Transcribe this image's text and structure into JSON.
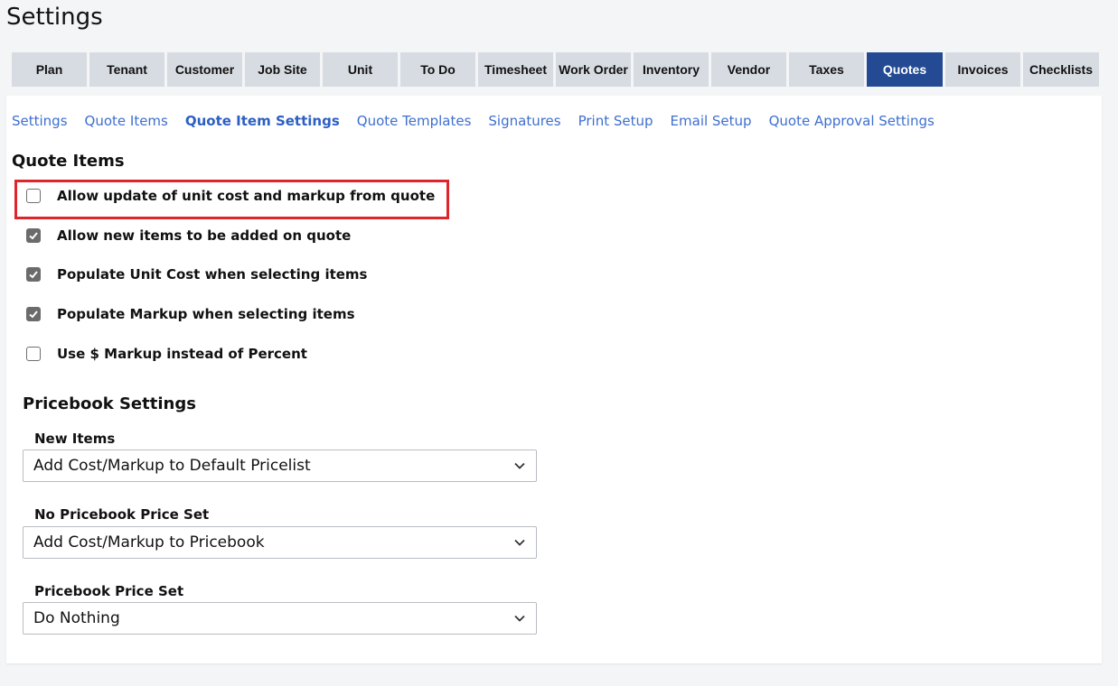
{
  "page": {
    "title": "Settings"
  },
  "tabs": [
    {
      "label": "Plan",
      "active": false
    },
    {
      "label": "Tenant",
      "active": false
    },
    {
      "label": "Customer",
      "active": false
    },
    {
      "label": "Job Site",
      "active": false
    },
    {
      "label": "Unit",
      "active": false
    },
    {
      "label": "To Do",
      "active": false
    },
    {
      "label": "Timesheet",
      "active": false
    },
    {
      "label": "Work Order",
      "active": false
    },
    {
      "label": "Inventory",
      "active": false
    },
    {
      "label": "Vendor",
      "active": false
    },
    {
      "label": "Taxes",
      "active": false
    },
    {
      "label": "Quotes",
      "active": true
    },
    {
      "label": "Invoices",
      "active": false
    },
    {
      "label": "Checklists",
      "active": false
    }
  ],
  "subnav": [
    {
      "label": "Settings",
      "active": false
    },
    {
      "label": "Quote Items",
      "active": false
    },
    {
      "label": "Quote Item Settings",
      "active": true
    },
    {
      "label": "Quote Templates",
      "active": false
    },
    {
      "label": "Signatures",
      "active": false
    },
    {
      "label": "Print Setup",
      "active": false
    },
    {
      "label": "Email Setup",
      "active": false
    },
    {
      "label": "Quote Approval Settings",
      "active": false
    }
  ],
  "quote_items": {
    "title": "Quote Items",
    "options": [
      {
        "label": "Allow update of unit cost and markup from quote",
        "checked": false
      },
      {
        "label": "Allow new items to be added on quote",
        "checked": true
      },
      {
        "label": "Populate Unit Cost when selecting items",
        "checked": true
      },
      {
        "label": "Populate Markup when selecting items",
        "checked": true
      },
      {
        "label": "Use $ Markup instead of Percent",
        "checked": false
      }
    ]
  },
  "pricebook": {
    "title": "Pricebook Settings",
    "fields": [
      {
        "label": "New Items",
        "value": "Add Cost/Markup to Default Pricelist"
      },
      {
        "label": "No Pricebook Price Set",
        "value": "Add Cost/Markup to Pricebook"
      },
      {
        "label": "Pricebook Price Set",
        "value": "Do Nothing"
      }
    ]
  },
  "colors": {
    "accent": "#234a93",
    "link": "#3e6fd0",
    "highlight": "#e0242b",
    "tab_bg": "#d7dce2"
  }
}
